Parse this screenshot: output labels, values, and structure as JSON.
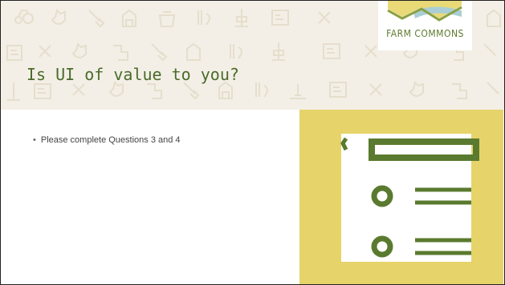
{
  "slide": {
    "title": "Is UI of value to you?",
    "bullets": [
      "Please complete Questions 3 and 4"
    ]
  },
  "logo": {
    "text": "FARM COMMONS"
  },
  "colors": {
    "banner_bg": "#f3efe6",
    "pattern": "#e6decd",
    "title": "#4a6b2b",
    "accent_yellow": "#e6d36a",
    "icon_green": "#5a7a2f"
  },
  "icons": {
    "pattern": [
      "tractor-icon",
      "chicken-icon",
      "shovel-icon",
      "barn-icon",
      "pot-icon",
      "carrot-icon",
      "sign-icon",
      "horse-icon",
      "pepper-icon"
    ],
    "illustration": "checklist-icon"
  }
}
